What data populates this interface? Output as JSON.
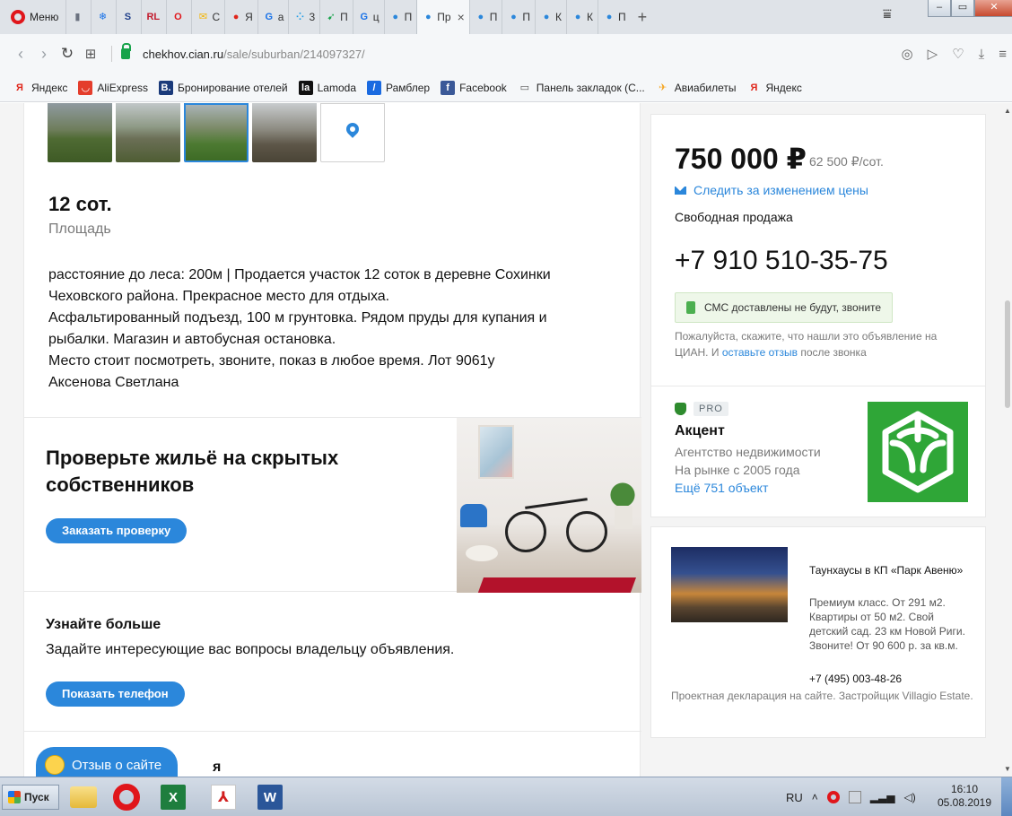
{
  "browser": {
    "menu_label": "Меню",
    "tabs": [
      {
        "icon": "document-icon",
        "glyph": "▮",
        "label": "",
        "color": "#6b7280"
      },
      {
        "icon": "snowflake-icon",
        "glyph": "❄",
        "label": "",
        "color": "#1a73e8"
      },
      {
        "icon": "s-logo-icon",
        "glyph": "S",
        "label": "",
        "color": "#1f3f8a"
      },
      {
        "icon": "rl-logo-icon",
        "glyph": "RL",
        "label": "",
        "color": "#c21b2d"
      },
      {
        "icon": "opera-icon",
        "glyph": "O",
        "label": "",
        "color": "#e0161b"
      },
      {
        "icon": "mail-icon",
        "glyph": "✉",
        "label": "C",
        "color": "#f4b400"
      },
      {
        "icon": "yandex-pin-icon",
        "glyph": "●",
        "label": "Я",
        "color": "#e0261b"
      },
      {
        "icon": "google-icon",
        "glyph": "G",
        "label": "a",
        "color": "#1a73e8"
      },
      {
        "icon": "dots-icon",
        "glyph": "⁘",
        "label": "3",
        "color": "#1a9be8"
      },
      {
        "icon": "arrow-icon",
        "glyph": "➹",
        "label": "П",
        "color": "#16a34a"
      },
      {
        "icon": "google-icon",
        "glyph": "G",
        "label": "ц",
        "color": "#1a73e8"
      },
      {
        "icon": "map-pin-icon",
        "glyph": "●",
        "label": "П",
        "color": "#2b87db"
      },
      {
        "icon": "map-pin-icon",
        "glyph": "●",
        "label": "Пр",
        "color": "#2b87db",
        "active": true
      },
      {
        "icon": "map-pin-icon",
        "glyph": "●",
        "label": "П",
        "color": "#2b87db"
      },
      {
        "icon": "map-pin-icon",
        "glyph": "●",
        "label": "П",
        "color": "#2b87db"
      },
      {
        "icon": "map-pin-icon",
        "glyph": "●",
        "label": "К",
        "color": "#2b87db"
      },
      {
        "icon": "map-pin-icon",
        "glyph": "●",
        "label": "К",
        "color": "#2b87db"
      },
      {
        "icon": "map-pin-icon",
        "glyph": "●",
        "label": "П",
        "color": "#2b87db"
      }
    ],
    "url_domain": "chekhov.cian.ru",
    "url_path": "/sale/suburban/214097327/",
    "bookmarks": [
      {
        "label": "Яндекс",
        "icon": "yandex-icon",
        "glyph": "Я",
        "bg": "transparent",
        "fg": "#e0261b"
      },
      {
        "label": "AliExpress",
        "icon": "aliexpress-icon",
        "glyph": "◡",
        "bg": "#e43d2c",
        "fg": "#fff"
      },
      {
        "label": "Бронирование отелей",
        "icon": "booking-icon",
        "glyph": "B.",
        "bg": "#1a3a7a",
        "fg": "#fff"
      },
      {
        "label": "Lamoda",
        "icon": "lamoda-icon",
        "glyph": "la",
        "bg": "#111",
        "fg": "#fff"
      },
      {
        "label": "Рамблер",
        "icon": "rambler-icon",
        "glyph": "/",
        "bg": "#1a6ae0",
        "fg": "#fff"
      },
      {
        "label": "Facebook",
        "icon": "facebook-icon",
        "glyph": "f",
        "bg": "#3b5998",
        "fg": "#fff"
      },
      {
        "label": "Панель закладок (С...",
        "icon": "folder-icon",
        "glyph": "▭",
        "bg": "transparent",
        "fg": "#555"
      },
      {
        "label": "Авиабилеты",
        "icon": "plane-icon",
        "glyph": "✈",
        "bg": "transparent",
        "fg": "#f5a623"
      },
      {
        "label": "Яндекс",
        "icon": "yandex-icon",
        "glyph": "Я",
        "bg": "transparent",
        "fg": "#e0261b"
      }
    ]
  },
  "listing": {
    "area_value": "12 сот.",
    "area_label": "Площадь",
    "description": [
      "расстояние до леса: 200м | Продается участок 12 соток в деревне Сохинки",
      "Чеховского района. Прекрасное место для отдыха.",
      "Асфальтированный подъезд, 100 м грунтовка. Рядом пруды для купания и",
      "рыбалки. Магазин и автобусная остановка.",
      "Место стоит посмотреть, звоните, показ в любое время. Лот 9061у",
      "Аксенова Светлана"
    ],
    "check": {
      "title": "Проверьте жильё на скрытых собственников",
      "button": "Заказать проверку"
    },
    "learn": {
      "title": "Узнайте больше",
      "text": "Задайте интересующие вас вопросы владельцу объявления.",
      "button": "Показать телефон"
    },
    "feedback_button": "Отзыв о сайте",
    "hidden_heading_tail": "я"
  },
  "sidebar": {
    "price": "750 000 ₽",
    "price_per": "62 500 ₽/сот.",
    "follow_price": "Следить за изменением цены",
    "sale_type": "Свободная продажа",
    "phone": "+7 910 510-35-75",
    "sms_note": "СМС доставлены не будут, звоните",
    "hint_before": "Пожалуйста, скажите, что нашли это объявление на ЦИАН. И ",
    "hint_link": "оставьте отзыв",
    "hint_after": " после звонка",
    "pro_badge": "PRO",
    "agency_name": "Акцент",
    "agency_type": "Агентство недвижимости",
    "agency_since": "На рынке с 2005 года",
    "agency_more": "Ещё 751 объект",
    "ad": {
      "title": "Таунхаусы в КП «Парк Авеню»",
      "text": "Премиум класс. От 291 м2. Квартиры от 50 м2. Свой детский сад. 23 км Новой Риги. Звоните! От 90 600 р. за кв.м.",
      "phone": "+7 (495) 003-48-26",
      "footer": "Проектная декларация на сайте. Застройщик Villagio Estate."
    }
  },
  "taskbar": {
    "start_label": "Пуск",
    "language": "RU",
    "time": "16:10",
    "date": "05.08.2019"
  },
  "colors": {
    "accent": "#2b87db",
    "agency_green": "#2fa637"
  }
}
